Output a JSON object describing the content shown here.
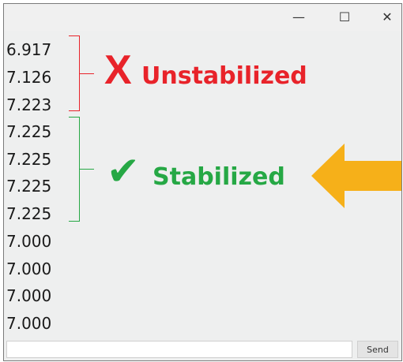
{
  "window": {
    "controls": {
      "minimize": "—",
      "maximize": "☐",
      "close": "✕"
    }
  },
  "serial_output": {
    "lines": [
      "6.917",
      "7.126",
      "7.223",
      "7.225",
      "7.225",
      "7.225",
      "7.225",
      "7.000",
      "7.000",
      "7.000",
      "7.000"
    ]
  },
  "annotations": {
    "unstabilized": {
      "mark": "X",
      "text": "Unstabilized",
      "color": "#e8232a"
    },
    "stabilized": {
      "mark": "✔",
      "text": "Stabilized",
      "color": "#26a845"
    },
    "arrow_color": "#f6b019"
  },
  "input_bar": {
    "input_value": "",
    "send_label": "Send"
  }
}
